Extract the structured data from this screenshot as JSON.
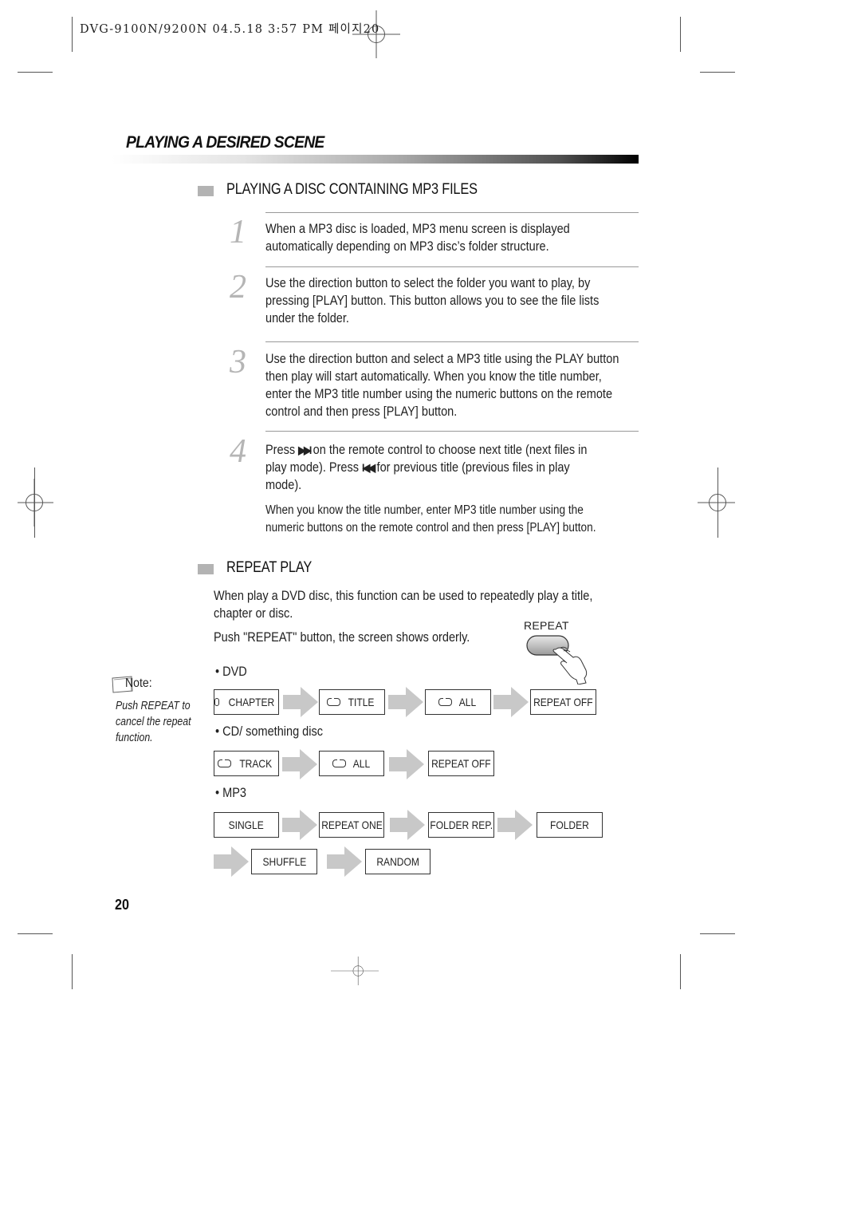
{
  "print_header": {
    "text": "DVG-9100N/9200N  04.5.18 3:57 PM 페이지20"
  },
  "page": {
    "title": "PLAYING A DESIRED SCENE",
    "number": "20"
  },
  "mp3_section": {
    "title": "PLAYING A DISC CONTAINING MP3 FILES",
    "steps": [
      {
        "number": "1",
        "lines": [
          "When a MP3 disc is loaded, MP3 menu screen is displayed",
          "automatically depending on MP3 disc’s folder structure."
        ]
      },
      {
        "number": "2",
        "lines": [
          "Use the direction button to select the folder you want to play, by",
          "pressing  [PLAY] button. This button allows you to see the file lists",
          "under the folder."
        ]
      },
      {
        "number": "3",
        "lines": [
          "Use the direction button and select a MP3 title using the PLAY button",
          "then play will start automatically. When you know the title number,",
          "enter the MP3 title number using the numeric buttons on the remote",
          "control and then press [PLAY] button."
        ]
      },
      {
        "number": "4",
        "line1_a": "Press ",
        "line1_icon": "next-track-icon",
        "line1_glyph": "▶▶I",
        "line1_b": " on the remote control to choose next title (next files in",
        "line2_a": "play mode). Press ",
        "line2_icon": "previous-track-icon",
        "line2_glyph": "I◀◀",
        "line2_b": " for previous title (previous files in play",
        "line3": "mode).",
        "extra_lines": [
          "When you know the title number, enter MP3 title number using the",
          "numeric buttons on the remote control and then press [PLAY] button."
        ]
      }
    ]
  },
  "repeat_section": {
    "title": "REPEAT PLAY",
    "intro_lines": [
      "When play a DVD disc, this function can be used to repeatedly play a title,",
      "chapter or disc."
    ],
    "push_text": "Push \"REPEAT\" button, the screen shows orderly.",
    "remote_button_label": "REPEAT",
    "note": {
      "label": "Note:",
      "lines": [
        "Push REPEAT to",
        "cancel the repeat",
        "function."
      ]
    },
    "flows": {
      "dvd": {
        "label": "• DVD",
        "steps": [
          "CHAPTER",
          "TITLE",
          "ALL",
          "REPEAT OFF"
        ]
      },
      "cd": {
        "label": "• CD/ something disc",
        "steps": [
          "TRACK",
          "ALL",
          "REPEAT OFF"
        ]
      },
      "mp3": {
        "label": "• MP3",
        "steps": [
          "SINGLE",
          "REPEAT ONE",
          "FOLDER REP.",
          "FOLDER",
          "SHUFFLE",
          "RANDOM"
        ]
      }
    }
  }
}
